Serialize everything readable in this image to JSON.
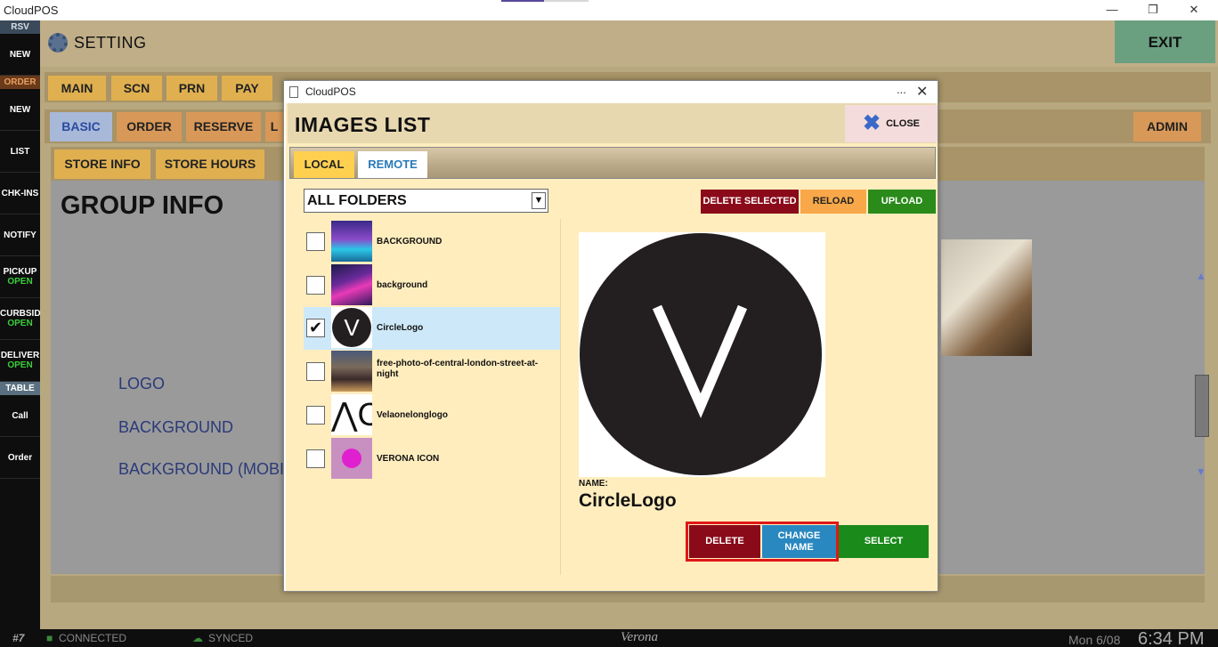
{
  "window": {
    "title": "CloudPOS",
    "minimize": "—",
    "maximize": "❐",
    "close": "✕"
  },
  "sidebar": {
    "rsv_header": "RSV",
    "new1": "NEW",
    "order_header": "ORDER",
    "new2": "NEW",
    "list": "LIST",
    "chkins": "CHK-INS",
    "notify": "NOTIFY",
    "pickup": "PICKUP",
    "pickup_status": "OPEN",
    "curbside": "CURBSID",
    "curbside_status": "OPEN",
    "delivery": "DELIVER",
    "delivery_status": "OPEN",
    "table_header": "TABLE",
    "call": "Call",
    "order": "Order"
  },
  "header": {
    "title": "SETTING",
    "exit": "EXIT"
  },
  "tabs_row1": [
    "MAIN",
    "SCN",
    "PRN",
    "PAY"
  ],
  "tabs_row2": [
    "BASIC",
    "ORDER",
    "RESERVE",
    "L"
  ],
  "admin_tab": "ADMIN",
  "tabs_row3": [
    "STORE INFO",
    "STORE HOURS"
  ],
  "group": {
    "title": "GROUP INFO",
    "labels": [
      "LOGO",
      "BACKGROUND",
      "BACKGROUND (MOBI"
    ]
  },
  "statusbar": {
    "station": "#7",
    "connected": "CONNECTED",
    "synced": "SYNCED",
    "brand": "Verona",
    "date": "Mon 6/08",
    "time": "6:34 PM"
  },
  "modal": {
    "window_title": "CloudPOS",
    "dots": "...",
    "close_x": "✕",
    "heading": "IMAGES LIST",
    "close_button": "CLOSE",
    "tabs": {
      "local": "LOCAL",
      "remote": "REMOTE"
    },
    "folder_select": "ALL FOLDERS",
    "buttons": {
      "delete_selected": "DELETE SELECTED",
      "reload": "RELOAD",
      "upload": "UPLOAD",
      "delete": "DELETE",
      "change_name": "CHANGE NAME",
      "select": "SELECT"
    },
    "images": [
      {
        "name": "BACKGROUND",
        "checked": false
      },
      {
        "name": "background",
        "checked": false
      },
      {
        "name": "CircleLogo",
        "checked": true
      },
      {
        "name": "free-photo-of-central-london-street-at-night",
        "checked": false
      },
      {
        "name": "Velaonelonglogo",
        "checked": false
      },
      {
        "name": "VERONA ICON",
        "checked": false
      }
    ],
    "preview": {
      "name_label": "NAME:",
      "name_value": "CircleLogo",
      "letter": "V"
    }
  },
  "colors": {
    "accent_yellow": "#ffd050",
    "delete_red": "#8a0a1a",
    "reload_orange": "#f8a848",
    "upload_green": "#2a8a1a",
    "change_blue": "#2a88c0"
  }
}
